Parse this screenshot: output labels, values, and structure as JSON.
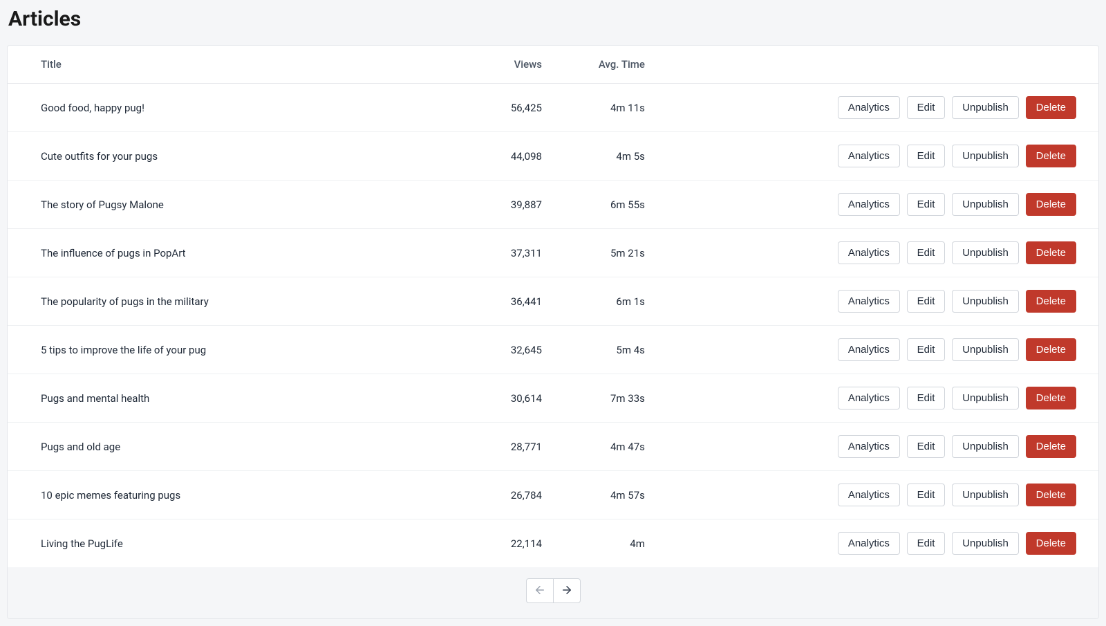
{
  "header": {
    "title": "Articles"
  },
  "table": {
    "columns": {
      "title": "Title",
      "views": "Views",
      "avg_time": "Avg. Time"
    },
    "actions": {
      "analytics": "Analytics",
      "edit": "Edit",
      "unpublish": "Unpublish",
      "delete": "Delete"
    },
    "rows": [
      {
        "title": "Good food, happy pug!",
        "views": "56,425",
        "avg_time": "4m 11s"
      },
      {
        "title": "Cute outfits for your pugs",
        "views": "44,098",
        "avg_time": "4m 5s"
      },
      {
        "title": "The story of Pugsy Malone",
        "views": "39,887",
        "avg_time": "6m 55s"
      },
      {
        "title": "The influence of pugs in PopArt",
        "views": "37,311",
        "avg_time": "5m 21s"
      },
      {
        "title": "The popularity of pugs in the military",
        "views": "36,441",
        "avg_time": "6m 1s"
      },
      {
        "title": "5 tips to improve the life of your pug",
        "views": "32,645",
        "avg_time": "5m 4s"
      },
      {
        "title": "Pugs and mental health",
        "views": "30,614",
        "avg_time": "7m 33s"
      },
      {
        "title": "Pugs and old age",
        "views": "28,771",
        "avg_time": "4m 47s"
      },
      {
        "title": "10 epic memes featuring pugs",
        "views": "26,784",
        "avg_time": "4m 57s"
      },
      {
        "title": "Living the PugLife",
        "views": "22,114",
        "avg_time": "4m"
      }
    ]
  }
}
